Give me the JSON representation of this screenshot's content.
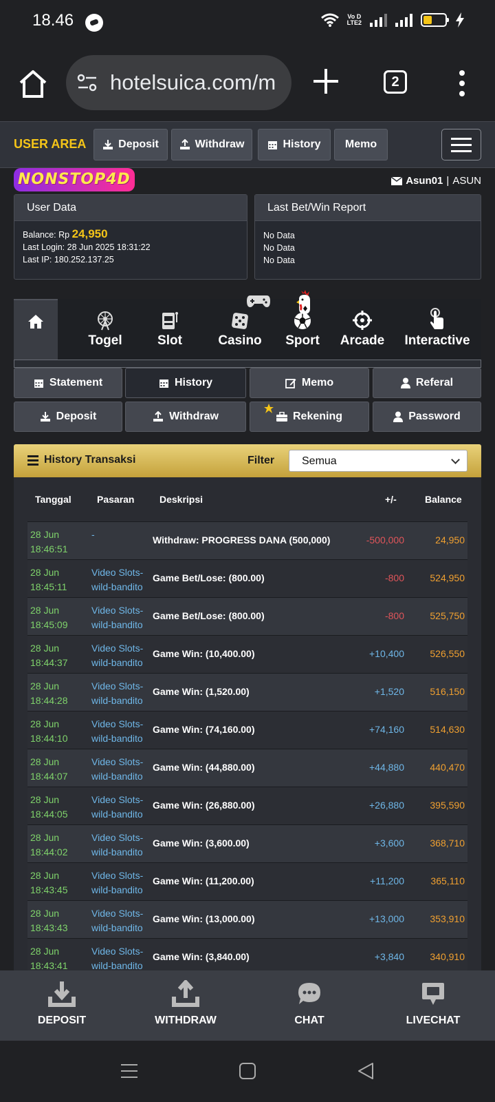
{
  "status_bar": {
    "time": "18.46",
    "volte_top": "Vo D",
    "volte_bottom": "LTE2"
  },
  "browser": {
    "url": "hotelsuica.com/m",
    "tab_count": "2"
  },
  "top_nav": {
    "user_area": "USER AREA",
    "deposit": "Deposit",
    "withdraw": "Withdraw",
    "history": "History",
    "memo": "Memo"
  },
  "logo_text": "NONSTOP4D",
  "user": {
    "username": "Asun01",
    "separator": "|",
    "name": "ASUN"
  },
  "user_data": {
    "title": "User Data",
    "balance_label": "Balance: Rp",
    "balance": "24,950",
    "last_login": "Last Login: 28 Jun 2025 18:31:22",
    "last_ip": "Last IP: 180.252.137.25"
  },
  "report": {
    "title": "Last Bet/Win Report",
    "lines": [
      "No Data",
      "No Data",
      "No Data"
    ]
  },
  "game_nav": {
    "items": [
      "Togel",
      "Slot",
      "Casino",
      "Sport",
      "Arcade",
      "Interactive"
    ]
  },
  "sub_nav": {
    "statement": "Statement",
    "history": "History",
    "memo": "Memo",
    "referal": "Referal",
    "deposit": "Deposit",
    "withdraw": "Withdraw",
    "rekening": "Rekening",
    "password": "Password"
  },
  "history": {
    "title": "History Transaksi",
    "filter_label": "Filter",
    "filter_value": "Semua",
    "columns": [
      "Tanggal",
      "Pasaran",
      "Deskripsi",
      "+/-",
      "Balance"
    ],
    "rows": [
      {
        "date": "28 Jun",
        "time": "18:46:51",
        "market1": "-",
        "market2": "",
        "desc": "Withdraw: PROGRESS DANA (500,000)",
        "amount": "-500,000",
        "balance": "24,950"
      },
      {
        "date": "28 Jun",
        "time": "18:45:11",
        "market1": "Video Slots-",
        "market2": "wild-bandito",
        "desc": "Game Bet/Lose: (800.00)",
        "amount": "-800",
        "balance": "524,950"
      },
      {
        "date": "28 Jun",
        "time": "18:45:09",
        "market1": "Video Slots-",
        "market2": "wild-bandito",
        "desc": "Game Bet/Lose: (800.00)",
        "amount": "-800",
        "balance": "525,750"
      },
      {
        "date": "28 Jun",
        "time": "18:44:37",
        "market1": "Video Slots-",
        "market2": "wild-bandito",
        "desc": "Game Win: (10,400.00)",
        "amount": "+10,400",
        "balance": "526,550"
      },
      {
        "date": "28 Jun",
        "time": "18:44:28",
        "market1": "Video Slots-",
        "market2": "wild-bandito",
        "desc": "Game Win: (1,520.00)",
        "amount": "+1,520",
        "balance": "516,150"
      },
      {
        "date": "28 Jun",
        "time": "18:44:10",
        "market1": "Video Slots-",
        "market2": "wild-bandito",
        "desc": "Game Win: (74,160.00)",
        "amount": "+74,160",
        "balance": "514,630"
      },
      {
        "date": "28 Jun",
        "time": "18:44:07",
        "market1": "Video Slots-",
        "market2": "wild-bandito",
        "desc": "Game Win: (44,880.00)",
        "amount": "+44,880",
        "balance": "440,470"
      },
      {
        "date": "28 Jun",
        "time": "18:44:05",
        "market1": "Video Slots-",
        "market2": "wild-bandito",
        "desc": "Game Win: (26,880.00)",
        "amount": "+26,880",
        "balance": "395,590"
      },
      {
        "date": "28 Jun",
        "time": "18:44:02",
        "market1": "Video Slots-",
        "market2": "wild-bandito",
        "desc": "Game Win: (3,600.00)",
        "amount": "+3,600",
        "balance": "368,710"
      },
      {
        "date": "28 Jun",
        "time": "18:43:45",
        "market1": "Video Slots-",
        "market2": "wild-bandito",
        "desc": "Game Win: (11,200.00)",
        "amount": "+11,200",
        "balance": "365,110"
      },
      {
        "date": "28 Jun",
        "time": "18:43:43",
        "market1": "Video Slots-",
        "market2": "wild-bandito",
        "desc": "Game Win: (13,000.00)",
        "amount": "+13,000",
        "balance": "353,910"
      },
      {
        "date": "28 Jun",
        "time": "18:43:41",
        "market1": "Video Slots-",
        "market2": "wild-bandito",
        "desc": "Game Win: (3,840.00)",
        "amount": "+3,840",
        "balance": "340,910"
      }
    ]
  },
  "bottom_bar": {
    "deposit": "DEPOSIT",
    "withdraw": "WITHDRAW",
    "chat": "CHAT",
    "livechat": "LIVECHAT"
  },
  "colors": {
    "accent": "#f5c518",
    "positive": "#6fb7e8",
    "negative": "#e0555a",
    "date": "#7fd36b",
    "balance": "#f0a030"
  }
}
